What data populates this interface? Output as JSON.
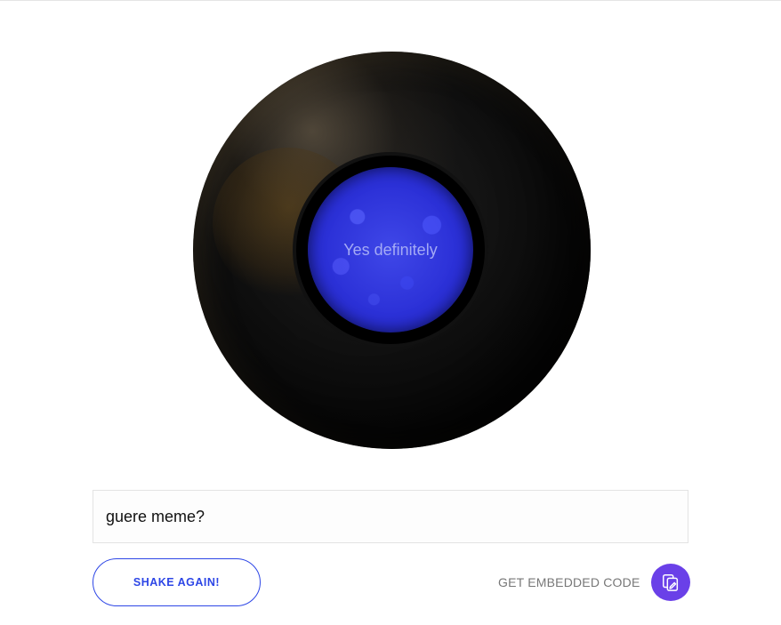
{
  "ball": {
    "answer": "Yes definitely"
  },
  "question": {
    "value": "guere meme?",
    "placeholder": ""
  },
  "actions": {
    "shake_label": "SHAKE AGAIN!",
    "embed_label": "GET EMBEDDED CODE"
  },
  "colors": {
    "accent": "#2d46e6",
    "embed_button": "#6a40e8",
    "liquid": "#2a2fd6"
  },
  "icons": {
    "embed": "copy-edit-icon"
  }
}
